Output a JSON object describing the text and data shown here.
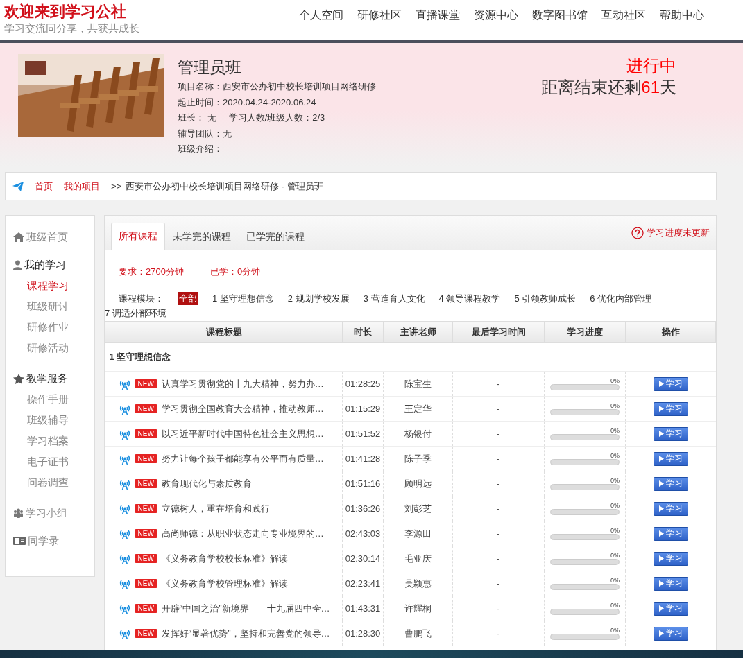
{
  "header": {
    "title": "欢迎来到学习公社",
    "slogan": "学习交流同分享，共获共成长",
    "nav": [
      {
        "label": "个人空间"
      },
      {
        "label": "研修社区"
      },
      {
        "label": "直播课堂"
      },
      {
        "label": "资源中心"
      },
      {
        "label": "数字图书馆"
      },
      {
        "label": "互动社区"
      },
      {
        "label": "帮助中心"
      }
    ]
  },
  "banner": {
    "picture": {
      "kind": "picture"
    },
    "class_name": "管理员班",
    "info_lines": [
      [
        "项目名称：西安市公办初中校长培训项目网络研修"
      ],
      [
        "起止时间：2020.04.24-2020.06.24"
      ],
      [
        "班长： 无",
        "学习人数/班级人数：2/3"
      ],
      [
        "辅导团队：无"
      ],
      [
        "班级介绍："
      ]
    ],
    "status": "进行中",
    "countdown": {
      "prefix": "距离结束还剩",
      "days": "61",
      "suffix": "天"
    }
  },
  "breadcrumb": {
    "links": [
      "首页",
      "我的项目"
    ],
    "separator": ">>",
    "current": "西安市公办初中校长培训项目网络研修 · 管理员班"
  },
  "sidebar": [
    {
      "label": "班级首页"
    },
    {
      "label": "我的学习",
      "children": [
        {
          "label": "课程学习",
          "selected": true
        },
        {
          "label": "班级研讨",
          "selected": false
        },
        {
          "label": "研修作业",
          "selected": false
        },
        {
          "label": "研修活动",
          "selected": false
        }
      ]
    },
    {
      "label": "教学服务",
      "children": [
        {
          "label": "操作手册",
          "selected": false
        },
        {
          "label": "班级辅导",
          "selected": false
        },
        {
          "label": "学习档案",
          "selected": false
        },
        {
          "label": "电子证书",
          "selected": false
        },
        {
          "label": "问卷调查",
          "selected": false
        }
      ]
    },
    {
      "label": "学习小组"
    },
    {
      "label": "同学录"
    }
  ],
  "tabs": [
    {
      "label": "所有课程",
      "selected": true
    },
    {
      "label": "未学完的课程",
      "selected": false
    },
    {
      "label": "已学完的课程",
      "selected": false
    }
  ],
  "progress_notice": "学习进度未更新",
  "requirement": "要求：2700分钟",
  "studied": "已学：0分钟",
  "modules": {
    "label": "课程模块：",
    "items": [
      {
        "label": "全部",
        "selected": true
      },
      {
        "label": "1 坚守理想信念",
        "selected": false
      },
      {
        "label": "2 规划学校发展",
        "selected": false
      },
      {
        "label": "3 营造育人文化",
        "selected": false
      },
      {
        "label": "4 领导课程教学",
        "selected": false
      },
      {
        "label": "5 引领教师成长",
        "selected": false
      },
      {
        "label": "6 优化内部管理",
        "selected": false
      },
      {
        "label": "7 调适外部环境",
        "selected": false
      }
    ]
  },
  "table": {
    "columns": [
      "课程标题",
      "时长",
      "主讲老师",
      "最后学习时间",
      "学习进度",
      "操作"
    ],
    "group": "1 坚守理想信念",
    "rows": [
      {
        "badge": "NEW",
        "title": "认真学习贯彻党的十九大精神，努力办…",
        "duration": "01:28:25",
        "teacher": "陈宝生",
        "last_study": "-",
        "progress": "0%",
        "level": 0,
        "action": "学习"
      },
      {
        "badge": "NEW",
        "title": "学习贯彻全国教育大会精神，推动教师…",
        "duration": "01:15:29",
        "teacher": "王定华",
        "last_study": "-",
        "progress": "0%",
        "level": 0,
        "action": "学习"
      },
      {
        "badge": "NEW",
        "title": "以习近平新时代中国特色社会主义思想…",
        "duration": "01:51:52",
        "teacher": "杨银付",
        "last_study": "-",
        "progress": "0%",
        "level": 0,
        "action": "学习"
      },
      {
        "badge": "NEW",
        "title": "努力让每个孩子都能享有公平而有质量…",
        "duration": "01:41:28",
        "teacher": "陈子季",
        "last_study": "-",
        "progress": "0%",
        "level": 0,
        "action": "学习"
      },
      {
        "badge": "NEW",
        "title": "教育现代化与素质教育",
        "duration": "01:51:16",
        "teacher": "顾明远",
        "last_study": "-",
        "progress": "0%",
        "level": 0,
        "action": "学习"
      },
      {
        "badge": "NEW",
        "title": "立德树人，重在培育和践行",
        "duration": "01:36:26",
        "teacher": "刘彭芝",
        "last_study": "-",
        "progress": "0%",
        "level": 0,
        "action": "学习"
      },
      {
        "badge": "NEW",
        "title": "高尚师德：从职业状态走向专业境界的…",
        "duration": "02:43:03",
        "teacher": "李源田",
        "last_study": "-",
        "progress": "0%",
        "level": 0,
        "action": "学习"
      },
      {
        "badge": "NEW",
        "title": "《义务教育学校校长标准》解读",
        "duration": "02:30:14",
        "teacher": "毛亚庆",
        "last_study": "-",
        "progress": "0%",
        "level": 0,
        "action": "学习"
      },
      {
        "badge": "NEW",
        "title": "《义务教育学校管理标准》解读",
        "duration": "02:23:41",
        "teacher": "吴颖惠",
        "last_study": "-",
        "progress": "0%",
        "level": 0,
        "action": "学习"
      },
      {
        "badge": "NEW",
        "title": "开辟“中国之治”新境界——十九届四中全…",
        "duration": "01:43:31",
        "teacher": "许耀桐",
        "last_study": "-",
        "progress": "0%",
        "level": 0,
        "action": "学习"
      },
      {
        "badge": "NEW",
        "title": "发挥好“显著优势”，坚持和完善党的领导…",
        "duration": "01:28:30",
        "teacher": "曹鹏飞",
        "last_study": "-",
        "progress": "0%",
        "level": 0,
        "action": "学习"
      }
    ]
  }
}
